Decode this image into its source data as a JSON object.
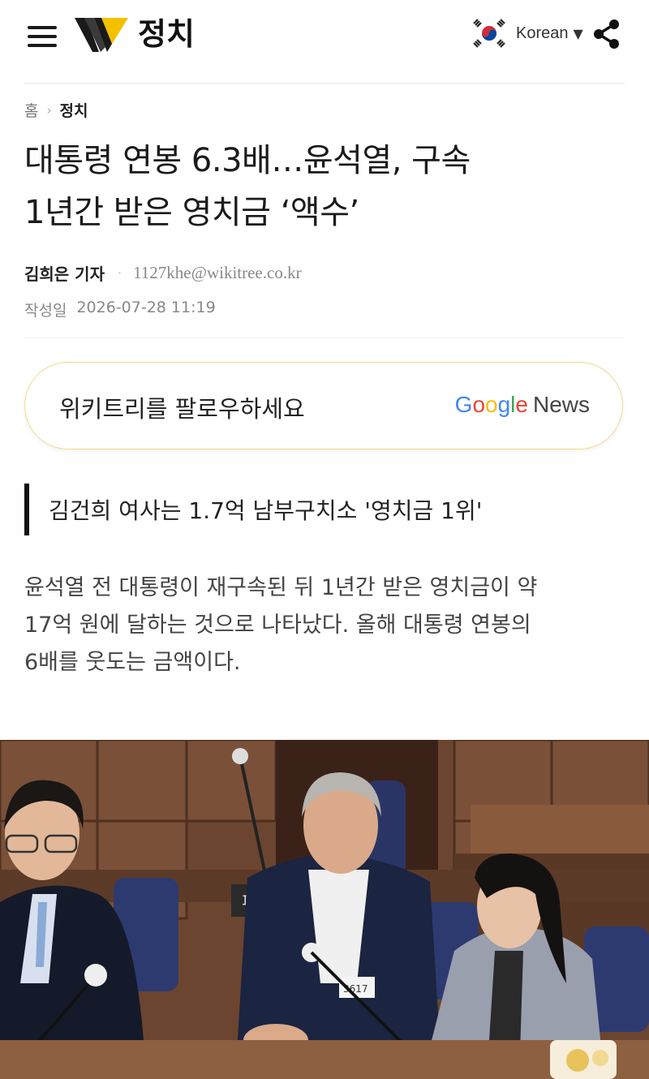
{
  "header": {
    "section": "정치",
    "language": "Korean",
    "logo_letter": "W"
  },
  "breadcrumb": {
    "home": "홈",
    "category": "정치"
  },
  "article": {
    "title_line1": "대통령 연봉 6.3배…윤석열, 구속",
    "title_line2": "1년간 받은 영치금 ‘액수’",
    "author": "김희은 기자",
    "email": "1127khe@wikitree.co.kr",
    "date_label": "작성일",
    "date": "2026-07-28 11:19",
    "subheadline": "김건희 여사는 1.7억 남부구치소 '영치금 1위'",
    "body_line1": "윤석열 전 대통령이 재구속된 뒤 1년간 받은 영치금이 약",
    "body_line2": "17억 원에 달하는 것으로 나타났다. 올해 대통령 연봉의",
    "body_line3": "6배를 웃도는 금액이다."
  },
  "follow_card": {
    "text": "위키트리를 팔로우하세요",
    "google": "Google",
    "news": "News"
  },
  "photo": {
    "sign_text": "피고",
    "badge_number": "3617"
  },
  "colors": {
    "logo_yellow": "#f2c200",
    "card_border": "#f2dc8a",
    "google_blue": "#4285f4",
    "google_red": "#ea4335",
    "google_yellow": "#fbbc05",
    "google_green": "#34a853"
  }
}
